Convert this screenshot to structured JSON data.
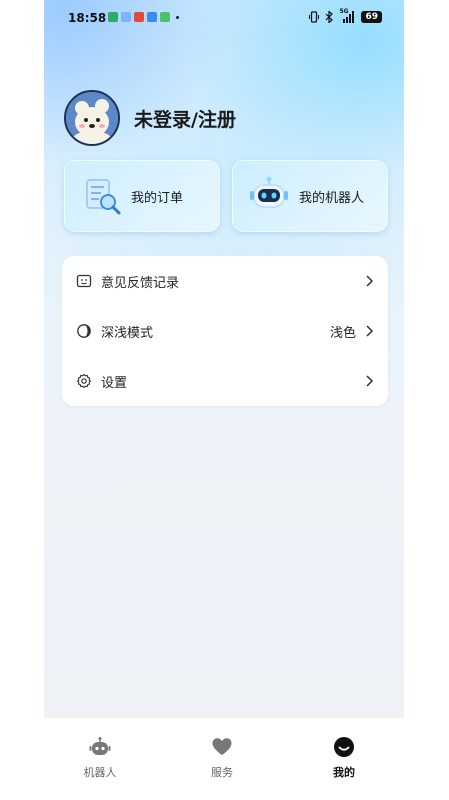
{
  "status_bar": {
    "time": "18:58",
    "battery": "69",
    "network": "5G"
  },
  "profile": {
    "username": "未登录/注册"
  },
  "cards": [
    {
      "label": "我的订单",
      "icon": "order-document-icon"
    },
    {
      "label": "我的机器人",
      "icon": "robot-icon"
    }
  ],
  "menu": {
    "items": [
      {
        "label": "意见反馈记录",
        "value": "",
        "icon": "feedback-icon"
      },
      {
        "label": "深浅模式",
        "value": "浅色",
        "icon": "theme-mode-icon"
      },
      {
        "label": "设置",
        "value": "",
        "icon": "settings-gear-icon"
      }
    ]
  },
  "tabbar": {
    "tabs": [
      {
        "label": "机器人",
        "icon": "robot-tab-icon",
        "active": false
      },
      {
        "label": "服务",
        "icon": "heart-icon",
        "active": false
      },
      {
        "label": "我的",
        "icon": "smile-icon",
        "active": true
      }
    ]
  },
  "colors": {
    "accent_blue": "#5fb7ff",
    "background_top": "#cfe9ff",
    "background_bottom": "#eef2f7"
  }
}
